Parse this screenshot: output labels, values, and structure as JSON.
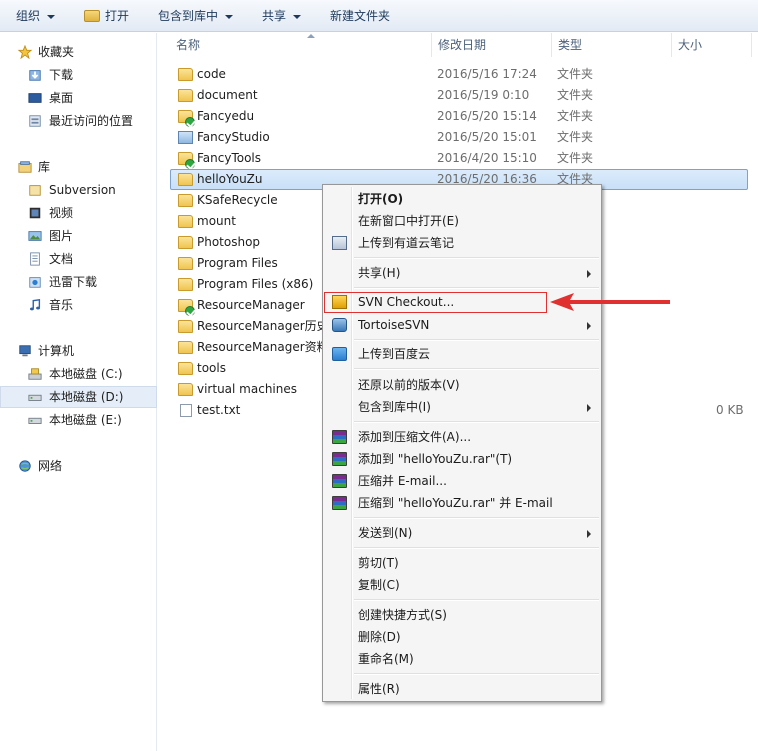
{
  "toolbar": {
    "organize": "组织",
    "open": "打开",
    "include_in_library": "包含到库中",
    "share": "共享",
    "new_folder": "新建文件夹"
  },
  "nav": {
    "favorites": "收藏夹",
    "downloads": "下载",
    "desktop": "桌面",
    "recent": "最近访问的位置",
    "libraries": "库",
    "subversion": "Subversion",
    "videos": "视频",
    "pictures": "图片",
    "documents": "文档",
    "xunlei": "迅雷下载",
    "music": "音乐",
    "computer": "计算机",
    "drive_c": "本地磁盘 (C:)",
    "drive_d": "本地磁盘 (D:)",
    "drive_e": "本地磁盘 (E:)",
    "network": "网络"
  },
  "columns": {
    "name": "名称",
    "date": "修改日期",
    "type": "类型",
    "size": "大小"
  },
  "files": [
    {
      "name": "code",
      "date": "2016/5/16 17:24",
      "type": "文件夹",
      "size": ""
    },
    {
      "name": "document",
      "date": "2016/5/19 0:10",
      "type": "文件夹",
      "size": ""
    },
    {
      "name": "Fancyedu",
      "date": "2016/5/20 15:14",
      "type": "文件夹",
      "size": ""
    },
    {
      "name": "FancyStudio",
      "date": "2016/5/20 15:01",
      "type": "文件夹",
      "size": ""
    },
    {
      "name": "FancyTools",
      "date": "2016/4/20 15:10",
      "type": "文件夹",
      "size": ""
    },
    {
      "name": "helloYouZu",
      "date": "2016/5/20 16:36",
      "type": "文件夹",
      "size": ""
    },
    {
      "name": "KSafeRecycle",
      "date": "",
      "type": "",
      "size": ""
    },
    {
      "name": "mount",
      "date": "",
      "type": "",
      "size": ""
    },
    {
      "name": "Photoshop",
      "date": "",
      "type": "",
      "size": ""
    },
    {
      "name": "Program Files",
      "date": "",
      "type": "",
      "size": ""
    },
    {
      "name": "Program Files (x86)",
      "date": "",
      "type": "",
      "size": ""
    },
    {
      "name": "ResourceManager",
      "date": "",
      "type": "",
      "size": ""
    },
    {
      "name": "ResourceManager历史",
      "date": "",
      "type": "",
      "size": ""
    },
    {
      "name": "ResourceManager资料",
      "date": "",
      "type": "",
      "size": ""
    },
    {
      "name": "tools",
      "date": "",
      "type": "",
      "size": ""
    },
    {
      "name": "virtual machines",
      "date": "",
      "type": "",
      "size": ""
    },
    {
      "name": "test.txt",
      "date": "",
      "type": "",
      "size": "0 KB"
    }
  ],
  "menu": {
    "open": "打开(O)",
    "open_new_window": "在新窗口中打开(E)",
    "upload_youdao": "上传到有道云笔记",
    "share": "共享(H)",
    "svn_checkout": "SVN Checkout...",
    "tortoise_svn": "TortoiseSVN",
    "upload_baidu": "上传到百度云",
    "restore_versions": "还原以前的版本(V)",
    "include_library": "包含到库中(I)",
    "add_archive": "添加到压缩文件(A)...",
    "add_to_rar": "添加到 \"helloYouZu.rar\"(T)",
    "compress_email": "压缩并 E-mail...",
    "compress_rar_email": "压缩到 \"helloYouZu.rar\" 并 E-mail",
    "send_to": "发送到(N)",
    "cut": "剪切(T)",
    "copy": "复制(C)",
    "create_shortcut": "创建快捷方式(S)",
    "delete": "删除(D)",
    "rename": "重命名(M)",
    "properties": "属性(R)"
  },
  "colors": {
    "selection": "#cce4f7",
    "annotation": "#e03030",
    "menu_bg": "#f5f5f5"
  }
}
